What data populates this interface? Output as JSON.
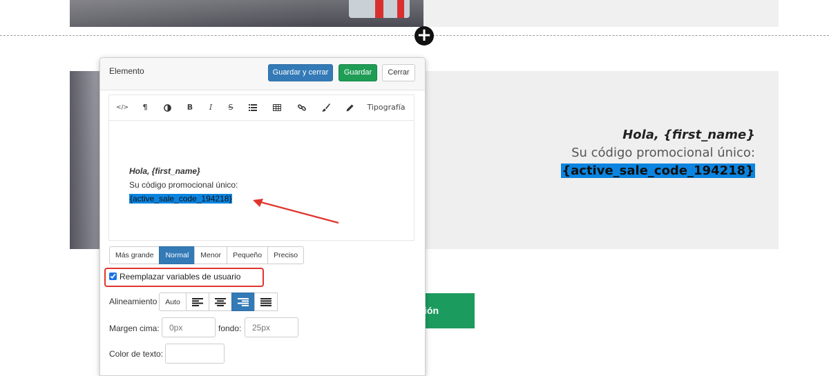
{
  "canvas": {
    "preview": {
      "greeting": "Hola, {first_name}",
      "line2": "Su código promocional único:",
      "code": "{active_sale_code_194218}"
    },
    "cta_button_label": "ción"
  },
  "panel": {
    "title": "Elemento",
    "buttons": {
      "save_close": "Guardar y cerrar",
      "save": "Guardar",
      "close": "Cerrar"
    },
    "toolbar": {
      "icons": [
        "code-icon",
        "paragraph-icon",
        "contrast-icon",
        "bold-icon",
        "italic-icon",
        "strikethrough-icon",
        "list-icon",
        "table-icon",
        "link-icon",
        "brush-icon",
        "pencil-icon"
      ],
      "glyphs": {
        "code": "</>",
        "paragraph": "¶",
        "bold": "B",
        "italic": "I",
        "strike": "S"
      },
      "typography_label": "Tipografía"
    },
    "editor_content": {
      "greeting": "Hola, {first_name}",
      "line2": "Su código promocional único:",
      "code": "{active_sale_code_194218}"
    },
    "size_options": [
      "Más grande",
      "Normal",
      "Menor",
      "Pequeño",
      "Preciso"
    ],
    "size_selected": "Normal",
    "replace_vars_label": "Reemplazar variables de usuario",
    "replace_vars_checked": true,
    "alignment": {
      "label": "Alineamiento",
      "auto_label": "Auto",
      "options": [
        "align-left-icon",
        "align-center-icon",
        "align-right-icon",
        "align-justify-icon"
      ],
      "selected": "align-right-icon"
    },
    "margin": {
      "top_label": "Margen cima:",
      "top_placeholder": "0px",
      "bottom_label": "fondo:",
      "bottom_placeholder": "25px"
    },
    "text_color_label": "Color de texto:"
  },
  "colors": {
    "primary": "#337ab7",
    "success": "#1f9d55",
    "highlight": "#0a84e0",
    "annotation": "#e0342c"
  }
}
